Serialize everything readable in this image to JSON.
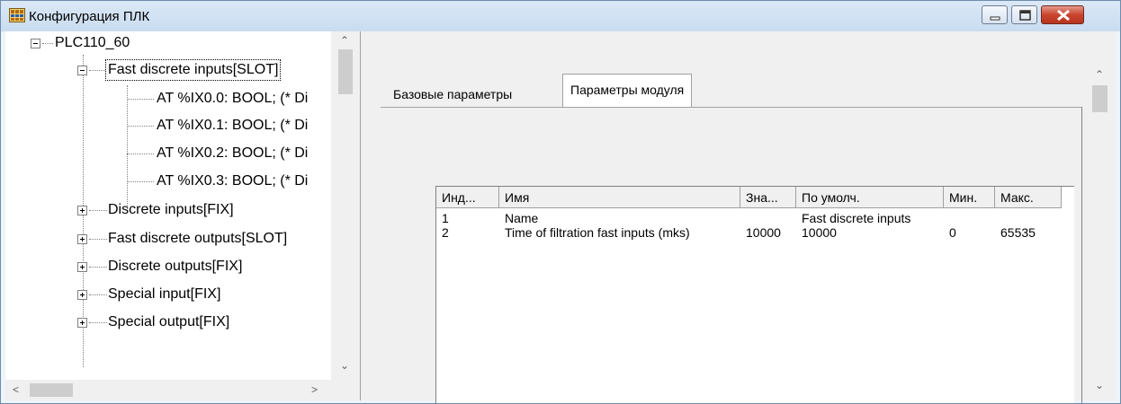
{
  "window": {
    "title": "Конфигурация ПЛК",
    "icon": "app-grid-icon",
    "buttons": {
      "minimize": "minimize-icon",
      "maximize": "maximize-icon",
      "close": "close-icon"
    }
  },
  "tree": {
    "root": {
      "label": "PLC110_60",
      "expanded": true
    },
    "nodes": [
      {
        "label": "Fast discrete inputs[SLOT]",
        "expanded": true,
        "selected": true
      },
      {
        "label": "AT %IX0.0: BOOL; (* Di"
      },
      {
        "label": "AT %IX0.1: BOOL; (* Di"
      },
      {
        "label": "AT %IX0.2: BOOL; (* Di"
      },
      {
        "label": "AT %IX0.3: BOOL; (* Di"
      },
      {
        "label": "Discrete inputs[FIX]",
        "expanded": false
      },
      {
        "label": "Fast discrete outputs[SLOT]",
        "expanded": false
      },
      {
        "label": "Discrete outputs[FIX]",
        "expanded": false
      },
      {
        "label": "Special input[FIX]",
        "expanded": false
      },
      {
        "label": "Special output[FIX]",
        "expanded": false
      }
    ]
  },
  "tabs": [
    {
      "label": "Базовые параметры",
      "active": false
    },
    {
      "label": "Параметры модуля",
      "active": true
    }
  ],
  "params_table": {
    "columns": [
      "Инд...",
      "Имя",
      "Зна...",
      "По умолч.",
      "Мин.",
      "Макс."
    ],
    "rows": [
      [
        "1",
        "Name",
        "",
        "Fast discrete inputs",
        "",
        ""
      ],
      [
        "2",
        "Time of filtration fast inputs (mks)",
        "10000",
        "10000",
        "0",
        "65535"
      ]
    ]
  },
  "colors": {
    "titlebar": "#c9dcf0",
    "close_button": "#c9452f",
    "window_bg": "#f0f0f0"
  }
}
